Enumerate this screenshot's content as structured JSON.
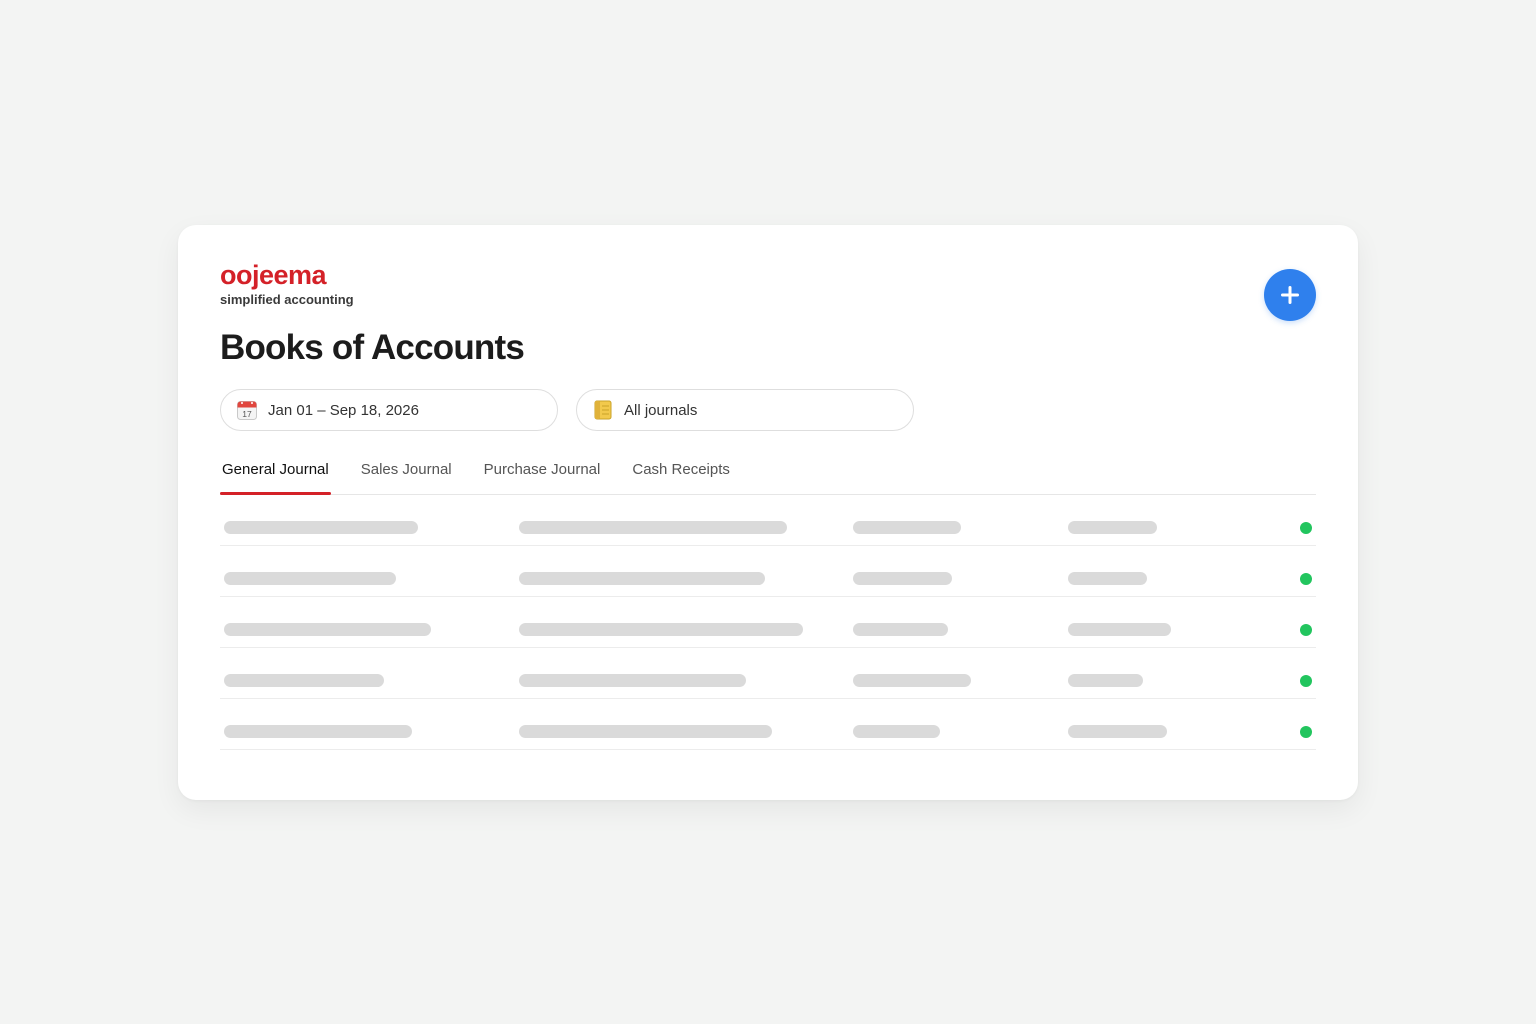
{
  "brand": {
    "name": "oojeema",
    "tagline": "simplified accounting",
    "color": "#d42128"
  },
  "header": {
    "title": "Books of Accounts",
    "add_button_icon": "plus-icon",
    "accent": "#2f80ed"
  },
  "filters": {
    "date_range": {
      "icon": "calendar-icon",
      "value": "Jan 01 – Sep 18, 2026"
    },
    "journal": {
      "icon": "notepad-icon",
      "value": "All journals"
    }
  },
  "tabs": [
    {
      "label": "General Journal",
      "active": true
    },
    {
      "label": "Sales Journal",
      "active": false
    },
    {
      "label": "Purchase Journal",
      "active": false
    },
    {
      "label": "Cash Receipts",
      "active": false
    }
  ],
  "table": {
    "state": "loading-skeleton",
    "row_count": 5,
    "status_color": "#22c55e",
    "placeholder_color": "#dadada"
  }
}
